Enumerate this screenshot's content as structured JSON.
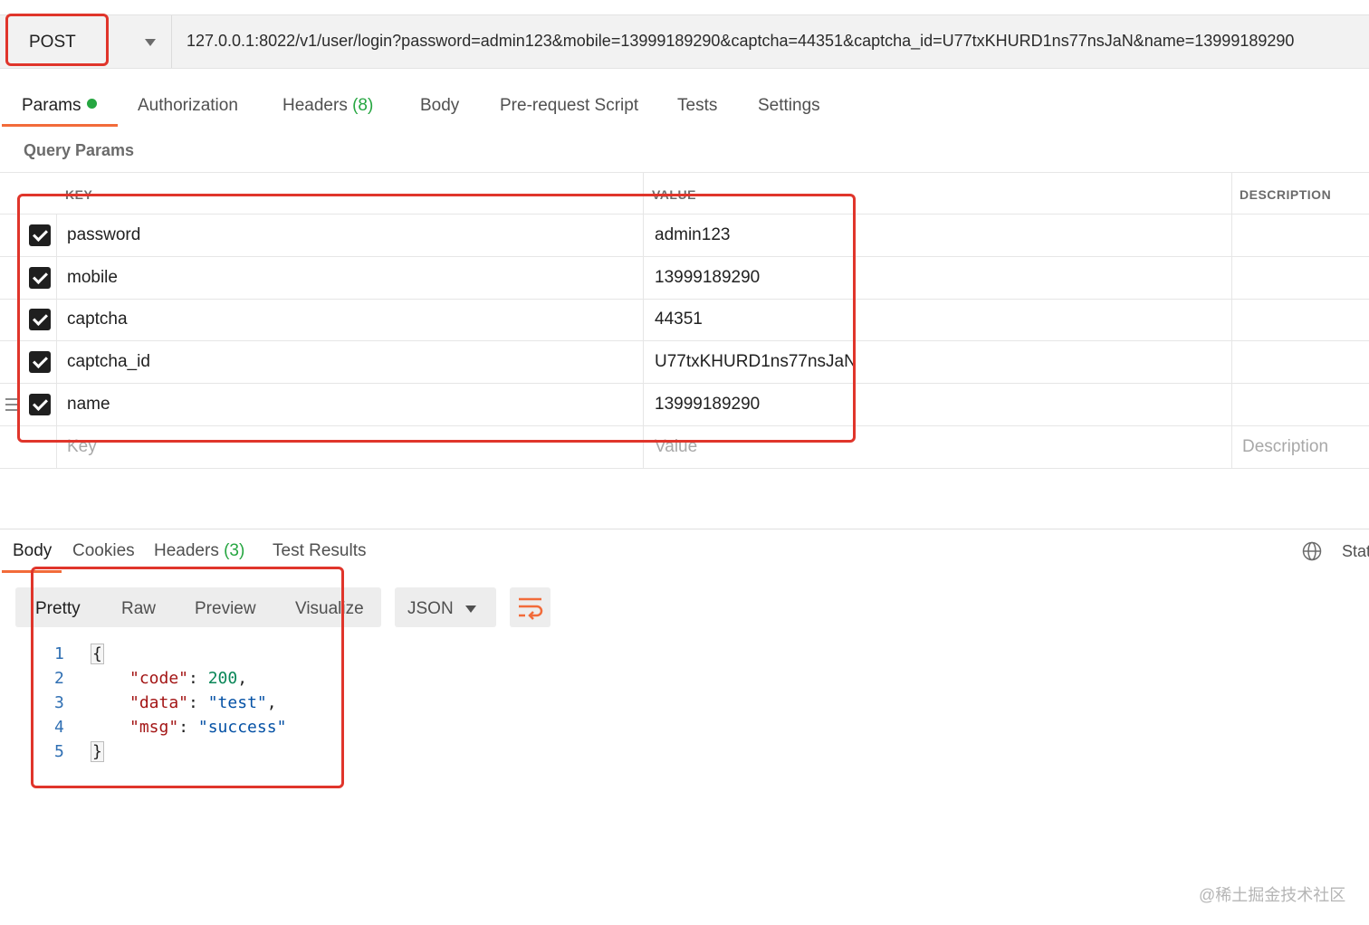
{
  "request": {
    "method": "POST",
    "url": "127.0.0.1:8022/v1/user/login?password=admin123&mobile=13999189290&captcha=44351&captcha_id=U77txKHURD1ns77nsJaN&name=13999189290"
  },
  "request_tabs": [
    {
      "label": "Params",
      "count": ""
    },
    {
      "label": "Authorization",
      "count": ""
    },
    {
      "label": "Headers",
      "count": "(8)"
    },
    {
      "label": "Body",
      "count": ""
    },
    {
      "label": "Pre-request Script",
      "count": ""
    },
    {
      "label": "Tests",
      "count": ""
    },
    {
      "label": "Settings",
      "count": ""
    }
  ],
  "query_params": {
    "title": "Query Params",
    "headers": {
      "key": "KEY",
      "value": "VALUE",
      "description": "DESCRIPTION"
    },
    "rows": [
      {
        "key": "password",
        "value": "admin123"
      },
      {
        "key": "mobile",
        "value": "13999189290"
      },
      {
        "key": "captcha",
        "value": "44351"
      },
      {
        "key": "captcha_id",
        "value": "U77txKHURD1ns77nsJaN"
      },
      {
        "key": "name",
        "value": "13999189290"
      }
    ],
    "placeholder": {
      "key": "Key",
      "value": "Value",
      "description": "Description"
    }
  },
  "response": {
    "tabs": [
      {
        "label": "Body",
        "count": ""
      },
      {
        "label": "Cookies",
        "count": ""
      },
      {
        "label": "Headers",
        "count": "(3)"
      },
      {
        "label": "Test Results",
        "count": ""
      }
    ],
    "status_label": "Stat",
    "views": [
      "Pretty",
      "Raw",
      "Preview",
      "Visualize"
    ],
    "format": "JSON",
    "code": {
      "line_numbers": [
        "1",
        "2",
        "3",
        "4",
        "5"
      ],
      "open_brace": "{",
      "close_brace": "}",
      "entries": [
        {
          "key": "\"code\"",
          "value": "200",
          "type": "num",
          "sep": ","
        },
        {
          "key": "\"data\"",
          "value": "\"test\"",
          "type": "str",
          "sep": ","
        },
        {
          "key": "\"msg\"",
          "value": "\"success\"",
          "type": "str",
          "sep": ""
        }
      ]
    }
  },
  "watermark": "@稀土掘金技术社区",
  "colors": {
    "accent": "#f26b3a",
    "success_green": "#26a641",
    "annotation_red": "#e0352b"
  }
}
